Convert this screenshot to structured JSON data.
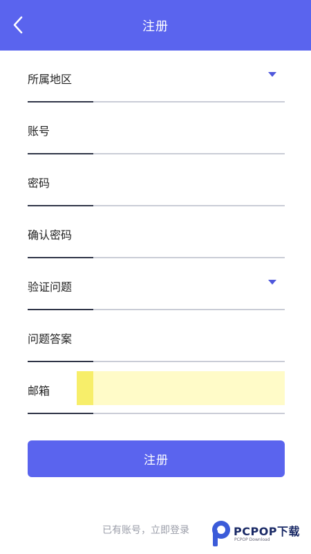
{
  "header": {
    "title": "注册",
    "back_icon": "chevron-left-icon",
    "background": "#5a64ee"
  },
  "fields": [
    {
      "label": "所属地区",
      "type": "dropdown",
      "value": ""
    },
    {
      "label": "账号",
      "type": "text",
      "value": ""
    },
    {
      "label": "密码",
      "type": "password",
      "value": ""
    },
    {
      "label": "确认密码",
      "type": "password",
      "value": ""
    },
    {
      "label": "验证问题",
      "type": "dropdown",
      "value": ""
    },
    {
      "label": "问题答案",
      "type": "text",
      "value": ""
    },
    {
      "label": "邮箱",
      "type": "email",
      "value": ""
    }
  ],
  "actions": {
    "submit_label": "注册",
    "login_link": "已有账号，立即登录"
  },
  "watermark": {
    "brand": "PCPOP下载",
    "sub": "PCPOP Download"
  },
  "colors": {
    "accent": "#5a64ee",
    "arrow": "#4f58dc",
    "highlight": "#fffbc8"
  }
}
